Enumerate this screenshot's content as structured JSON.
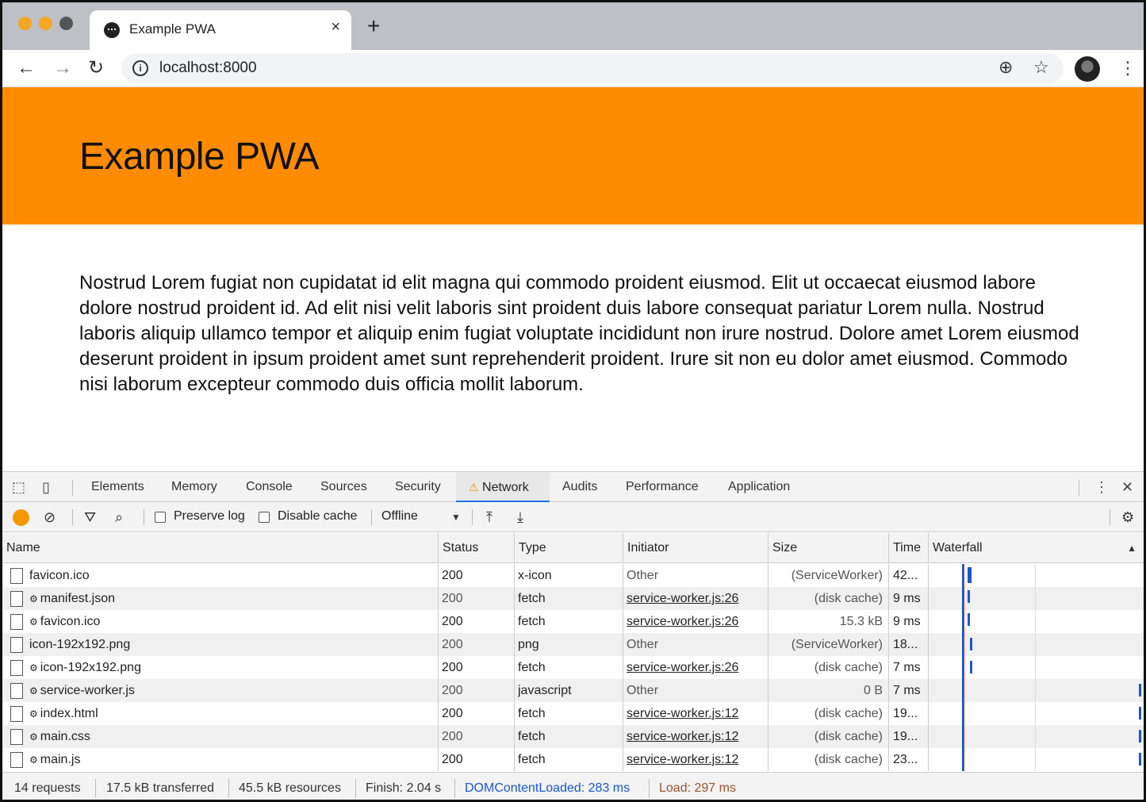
{
  "browser": {
    "tab_title": "Example PWA",
    "tab_close": "×",
    "new_tab": "+",
    "url": "localhost:8000"
  },
  "page": {
    "heading": "Example PWA",
    "paragraph": "Nostrud Lorem fugiat non cupidatat id elit magna qui commodo proident eiusmod. Elit ut occaecat eiusmod labore dolore nostrud proident id. Ad elit nisi velit laboris sint proident duis labore consequat pariatur Lorem nulla. Nostrud laboris aliquip ullamco tempor et aliquip enim fugiat voluptate incididunt non irure nostrud. Dolore amet Lorem eiusmod deserunt proident in ipsum proident amet sunt reprehenderit proident. Irure sit non eu dolor amet eiusmod. Commodo nisi laborum excepteur commodo duis officia mollit laborum.",
    "hero_color": "#ff8c00"
  },
  "devtools": {
    "tabs": [
      "Elements",
      "Memory",
      "Console",
      "Sources",
      "Security",
      "Network",
      "Audits",
      "Performance",
      "Application"
    ],
    "active_tab": "Network",
    "preserve_log": "Preserve log",
    "disable_cache": "Disable cache",
    "throttle": "Offline",
    "columns": [
      "Name",
      "Status",
      "Type",
      "Initiator",
      "Size",
      "Time",
      "Waterfall"
    ],
    "rows": [
      {
        "name": "favicon.ico",
        "sw": false,
        "status": "200",
        "type": "x-icon",
        "initiator": "Other",
        "initiator_link": false,
        "size": "(ServiceWorker)",
        "time": "42..."
      },
      {
        "name": "manifest.json",
        "sw": true,
        "status": "200",
        "type": "fetch",
        "initiator": "service-worker.js:26",
        "initiator_link": true,
        "size": "(disk cache)",
        "time": "9 ms"
      },
      {
        "name": "favicon.ico",
        "sw": true,
        "status": "200",
        "type": "fetch",
        "initiator": "service-worker.js:26",
        "initiator_link": true,
        "size": "15.3 kB",
        "time": "9 ms"
      },
      {
        "name": "icon-192x192.png",
        "sw": false,
        "status": "200",
        "type": "png",
        "initiator": "Other",
        "initiator_link": false,
        "size": "(ServiceWorker)",
        "time": "18..."
      },
      {
        "name": "icon-192x192.png",
        "sw": true,
        "status": "200",
        "type": "fetch",
        "initiator": "service-worker.js:26",
        "initiator_link": true,
        "size": "(disk cache)",
        "time": "7 ms"
      },
      {
        "name": "service-worker.js",
        "sw": true,
        "status": "200",
        "type": "javascript",
        "initiator": "Other",
        "initiator_link": false,
        "size": "0 B",
        "time": "7 ms"
      },
      {
        "name": "index.html",
        "sw": true,
        "status": "200",
        "type": "fetch",
        "initiator": "service-worker.js:12",
        "initiator_link": true,
        "size": "(disk cache)",
        "time": "19..."
      },
      {
        "name": "main.css",
        "sw": true,
        "status": "200",
        "type": "fetch",
        "initiator": "service-worker.js:12",
        "initiator_link": true,
        "size": "(disk cache)",
        "time": "19..."
      },
      {
        "name": "main.js",
        "sw": true,
        "status": "200",
        "type": "fetch",
        "initiator": "service-worker.js:12",
        "initiator_link": true,
        "size": "(disk cache)",
        "time": "23..."
      }
    ],
    "summary": {
      "requests": "14 requests",
      "transferred": "17.5 kB transferred",
      "resources": "45.5 kB resources",
      "finish": "Finish: 2.04 s",
      "dcl": "DOMContentLoaded: 283 ms",
      "load": "Load: 297 ms"
    },
    "record_color": "#f29900",
    "waterfall_color": "#1a56d6"
  }
}
